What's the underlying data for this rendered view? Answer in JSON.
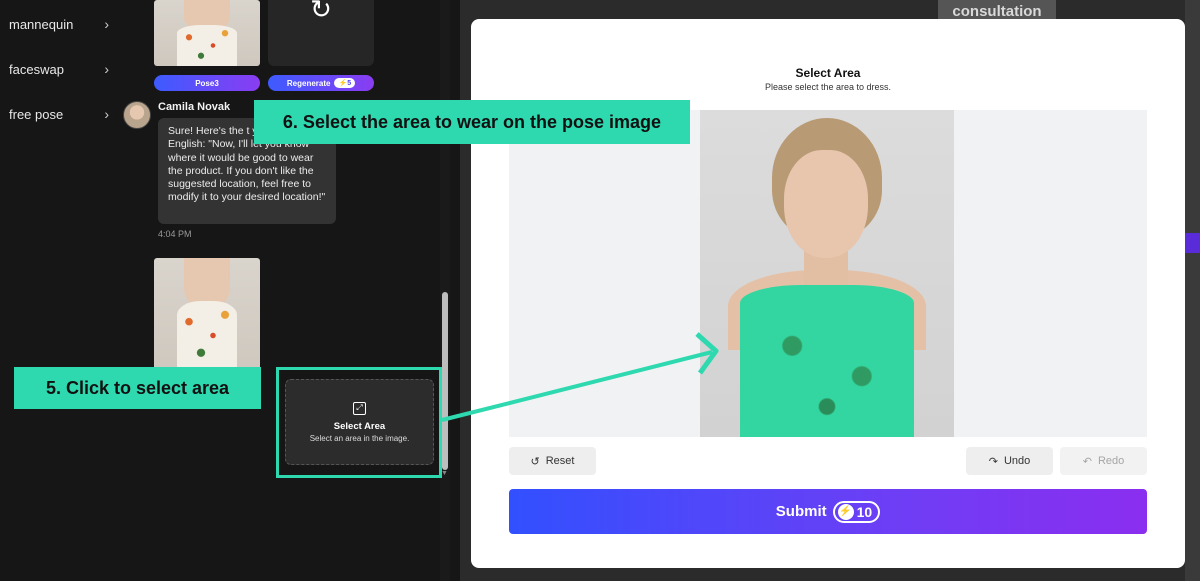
{
  "sidebar": {
    "items": [
      {
        "label": "mannequin",
        "icon": "chevron-right-icon"
      },
      {
        "label": "faceswap",
        "icon": "chevron-right-icon"
      },
      {
        "label": "free pose",
        "icon": "chevron-right-icon"
      }
    ]
  },
  "chat": {
    "pose_button": "Pose3",
    "regenerate_button": "Regenerate",
    "regenerate_cost": "5",
    "regenerate_icon": "refresh-icon",
    "author": "Camila Novak",
    "message": "Sure! Here's the t your text into English: \"Now, I'll let you know where it would be good to wear the product. If you don't like the suggested location, feel free to modify it to your desired location!\"",
    "time": "4:04 PM",
    "select_card": {
      "title": "Select Area",
      "subtitle": "Select an area in the image.",
      "icon": "expand-icon"
    }
  },
  "background": {
    "consultation": "consultation"
  },
  "modal": {
    "title": "Select Area",
    "subtitle": "Please select the area to dress.",
    "reset": "Reset",
    "undo": "Undo",
    "redo": "Redo",
    "submit": "Submit",
    "submit_cost": "10"
  },
  "annotations": {
    "step5": "5. Click to select area",
    "step6": "6. Select the area to wear on the pose image",
    "accent": "#2fd9b0"
  }
}
